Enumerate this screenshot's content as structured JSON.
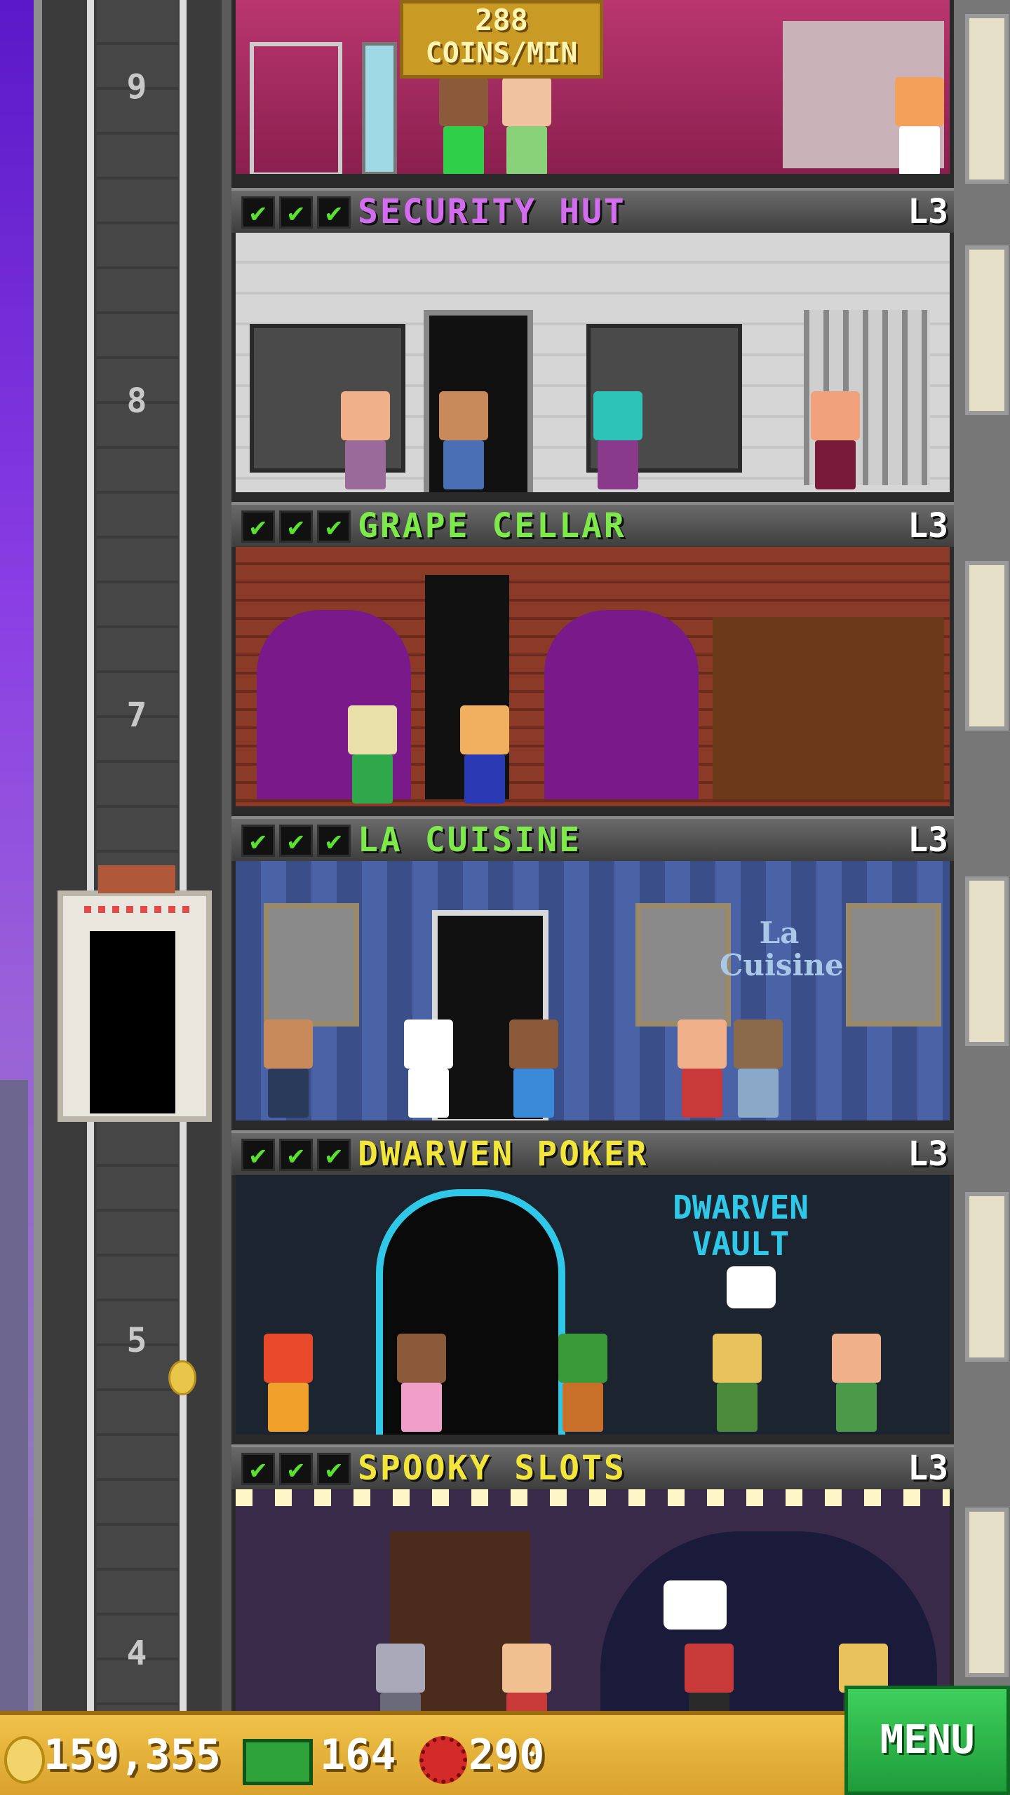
{
  "hud_top": {
    "rate_value": "288",
    "rate_unit": "COINS/MIN"
  },
  "shaft": {
    "floor_numbers": [
      "9",
      "8",
      "7",
      "5",
      "4"
    ]
  },
  "rooms": [
    {
      "name": "SECURITY HUT",
      "level": "L3",
      "color": "#d46cf0",
      "checks": [
        "✔",
        "✔",
        "✔"
      ]
    },
    {
      "name": "GRAPE CELLAR",
      "level": "L3",
      "color": "#7ee94a",
      "checks": [
        "✔",
        "✔",
        "✔"
      ]
    },
    {
      "name": "LA CUISINE",
      "level": "L3",
      "color": "#7ee94a",
      "checks": [
        "✔",
        "✔",
        "✔"
      ]
    },
    {
      "name": "DWARVEN POKER",
      "level": "L3",
      "color": "#f2e63a",
      "checks": [
        "✔",
        "✔",
        "✔"
      ]
    },
    {
      "name": "SPOOKY SLOTS",
      "level": "L3",
      "color": "#f2e63a",
      "checks": [
        "✔",
        "✔",
        "✔"
      ]
    }
  ],
  "signs": {
    "la_cuisine": "La Cuisine",
    "dwarven_vault": "DWARVEN VAULT"
  },
  "bottom_bar": {
    "coins": "159,355",
    "bux": "164",
    "gems": "290",
    "menu_label": "MENU"
  }
}
